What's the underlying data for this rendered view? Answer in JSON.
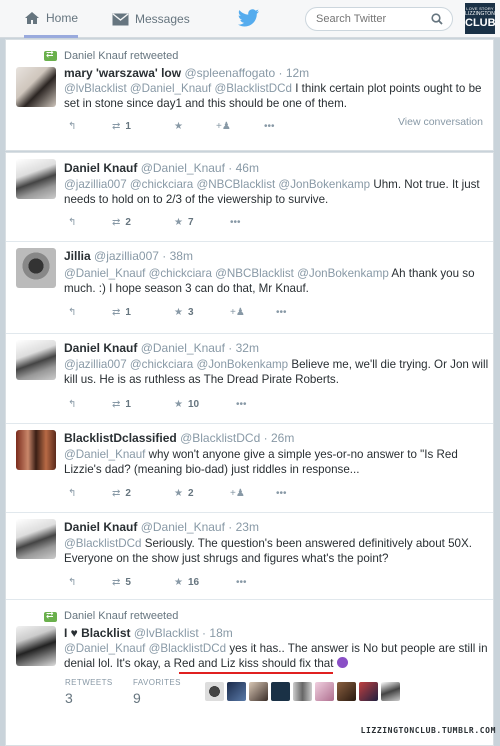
{
  "nav": {
    "home": "Home",
    "messages": "Messages"
  },
  "search": {
    "placeholder": "Search Twitter"
  },
  "logo": {
    "line1": "LOVE STORY",
    "line2": "LIZZINGTON",
    "line3": "CLUB"
  },
  "tweets": [
    {
      "retweet_by": "Daniel Knauf retweeted",
      "name": "mary 'warszawa' low",
      "handle": "@spleenaffogato",
      "time": "12m",
      "mentions": "@lvBlacklist @Daniel_Knauf @BlacklistDCd",
      "text": " I think certain plot points ought to be set in stone since day1 and this should be one of them.",
      "retweets": "1",
      "favorites": "",
      "view_conversation": "View conversation"
    },
    {
      "name": "Daniel Knauf",
      "handle": "@Daniel_Knauf",
      "time": "46m",
      "mentions": "@jazillia007 @chickciara @NBCBlacklist @JonBokenkamp",
      "text": " Uhm. Not true. It just needs to hold on to 2/3 of the viewership to survive.",
      "retweets": "2",
      "favorites": "7"
    },
    {
      "name": "Jillia",
      "handle": "@jazillia007",
      "time": "38m",
      "mentions": "@Daniel_Knauf @chickciara @NBCBlacklist @JonBokenkamp",
      "text": " Ah thank you so much. :) I hope season 3 can do that, Mr Knauf.",
      "retweets": "1",
      "favorites": "3"
    },
    {
      "name": "Daniel Knauf",
      "handle": "@Daniel_Knauf",
      "time": "32m",
      "mentions": "@jazillia007 @chickciara @JonBokenkamp",
      "text": " Believe me, we'll die trying. Or Jon will kill us. He is as ruthless as The Dread Pirate Roberts.",
      "retweets": "1",
      "favorites": "10"
    },
    {
      "name": "BlacklistDclassified",
      "handle": "@BlacklistDCd",
      "time": "26m",
      "mentions": "@Daniel_Knauf",
      "text": " why won't anyone give a simple yes-or-no answer to \"Is Red Lizzie's dad? (meaning bio-dad) just riddles in response...",
      "retweets": "2",
      "favorites": "2"
    },
    {
      "name": "Daniel Knauf",
      "handle": "@Daniel_Knauf",
      "time": "23m",
      "mentions": "@BlacklistDCd",
      "text": " Seriously. The question's been answered definitively about 50X. Everyone on the show just shrugs and figures what's the point?",
      "retweets": "5",
      "favorites": "16"
    },
    {
      "retweet_by": "Daniel Knauf retweeted",
      "name": "I ♥ Blacklist",
      "handle": "@lvBlacklist",
      "time": "18m",
      "mentions": "@Daniel_Knauf @BlacklistDCd",
      "text": " yes it has.. The answer is No but people are still in denial lol. It's okay, a Red and Liz kiss should fix that",
      "retweets_label": "RETWEETS",
      "retweets": "3",
      "favorites_label": "FAVORITES",
      "favorites": "9"
    }
  ],
  "footer": "LIZZINGTONCLUB.TUMBLR.COM",
  "colors": {
    "twitter_blue": "#55acee",
    "retweet_green": "#6ab04c",
    "underline_red": "#e02020"
  }
}
